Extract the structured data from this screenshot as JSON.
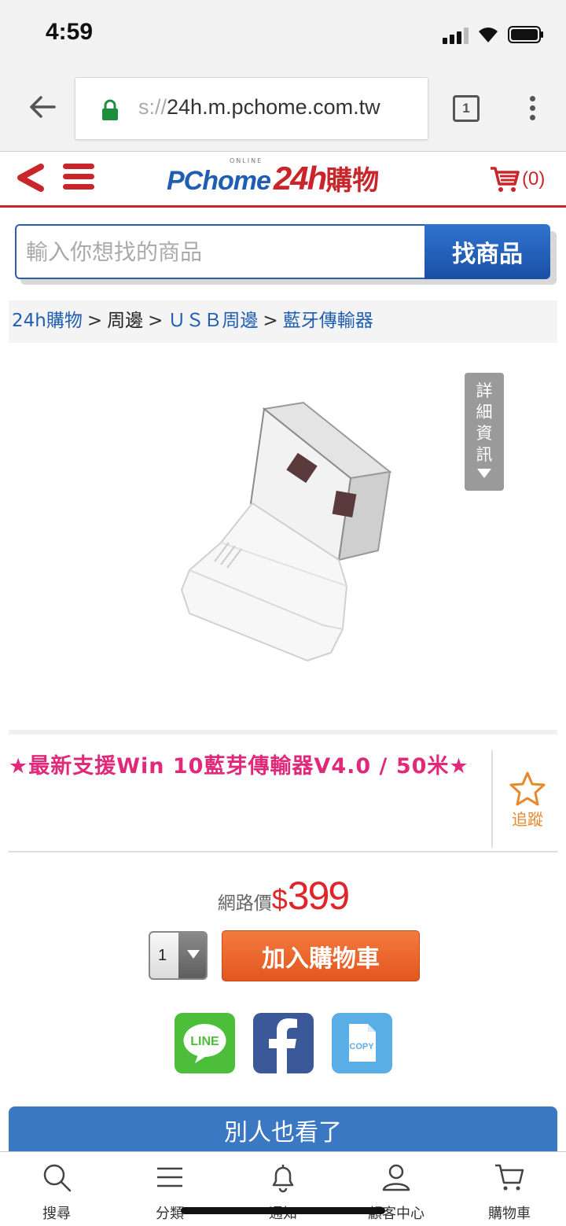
{
  "status_bar": {
    "time": "4:59"
  },
  "browser": {
    "url_prefix": "s://",
    "url_main": "24h.m.pchome.com.tw",
    "tab_count": "1"
  },
  "header": {
    "logo_pc": "PChome",
    "logo_online": "ONLINE",
    "logo_24h": "24h",
    "logo_shop": "購物",
    "cart_count": "(0)"
  },
  "search": {
    "placeholder": "輸入你想找的商品",
    "button_label": "找商品"
  },
  "breadcrumb": [
    {
      "label": "24h購物"
    },
    {
      "label": "周邊"
    },
    {
      "label": "ＵＳＢ周邊"
    },
    {
      "label": "藍牙傳輸器"
    }
  ],
  "product": {
    "details_tab": "詳細資訊",
    "title": "★最新支援Win 10藍芽傳輸器V4.0 / 50米★",
    "track_label": "追蹤",
    "price_label": "網路價",
    "price_currency": "$",
    "price_value": "399",
    "quantity": "1",
    "add_to_cart": "加入購物車"
  },
  "share": {
    "line_label": "LINE",
    "copy_label": "COPY"
  },
  "others_viewed": "別人也看了",
  "bottom_nav": [
    {
      "label": "搜尋",
      "icon": "search-icon"
    },
    {
      "label": "分類",
      "icon": "menu-icon"
    },
    {
      "label": "通知",
      "icon": "bell-icon"
    },
    {
      "label": "顧客中心",
      "icon": "user-icon"
    },
    {
      "label": "購物車",
      "icon": "cart-icon"
    }
  ],
  "colors": {
    "brand_red": "#c9262b",
    "brand_blue": "#1f5eb2",
    "title_pink": "#e0297a",
    "price_red": "#e0262b",
    "cart_orange": "#e2571f",
    "line_green": "#4cbe3a",
    "facebook_blue": "#3b5998",
    "copy_blue": "#5aaee6"
  }
}
